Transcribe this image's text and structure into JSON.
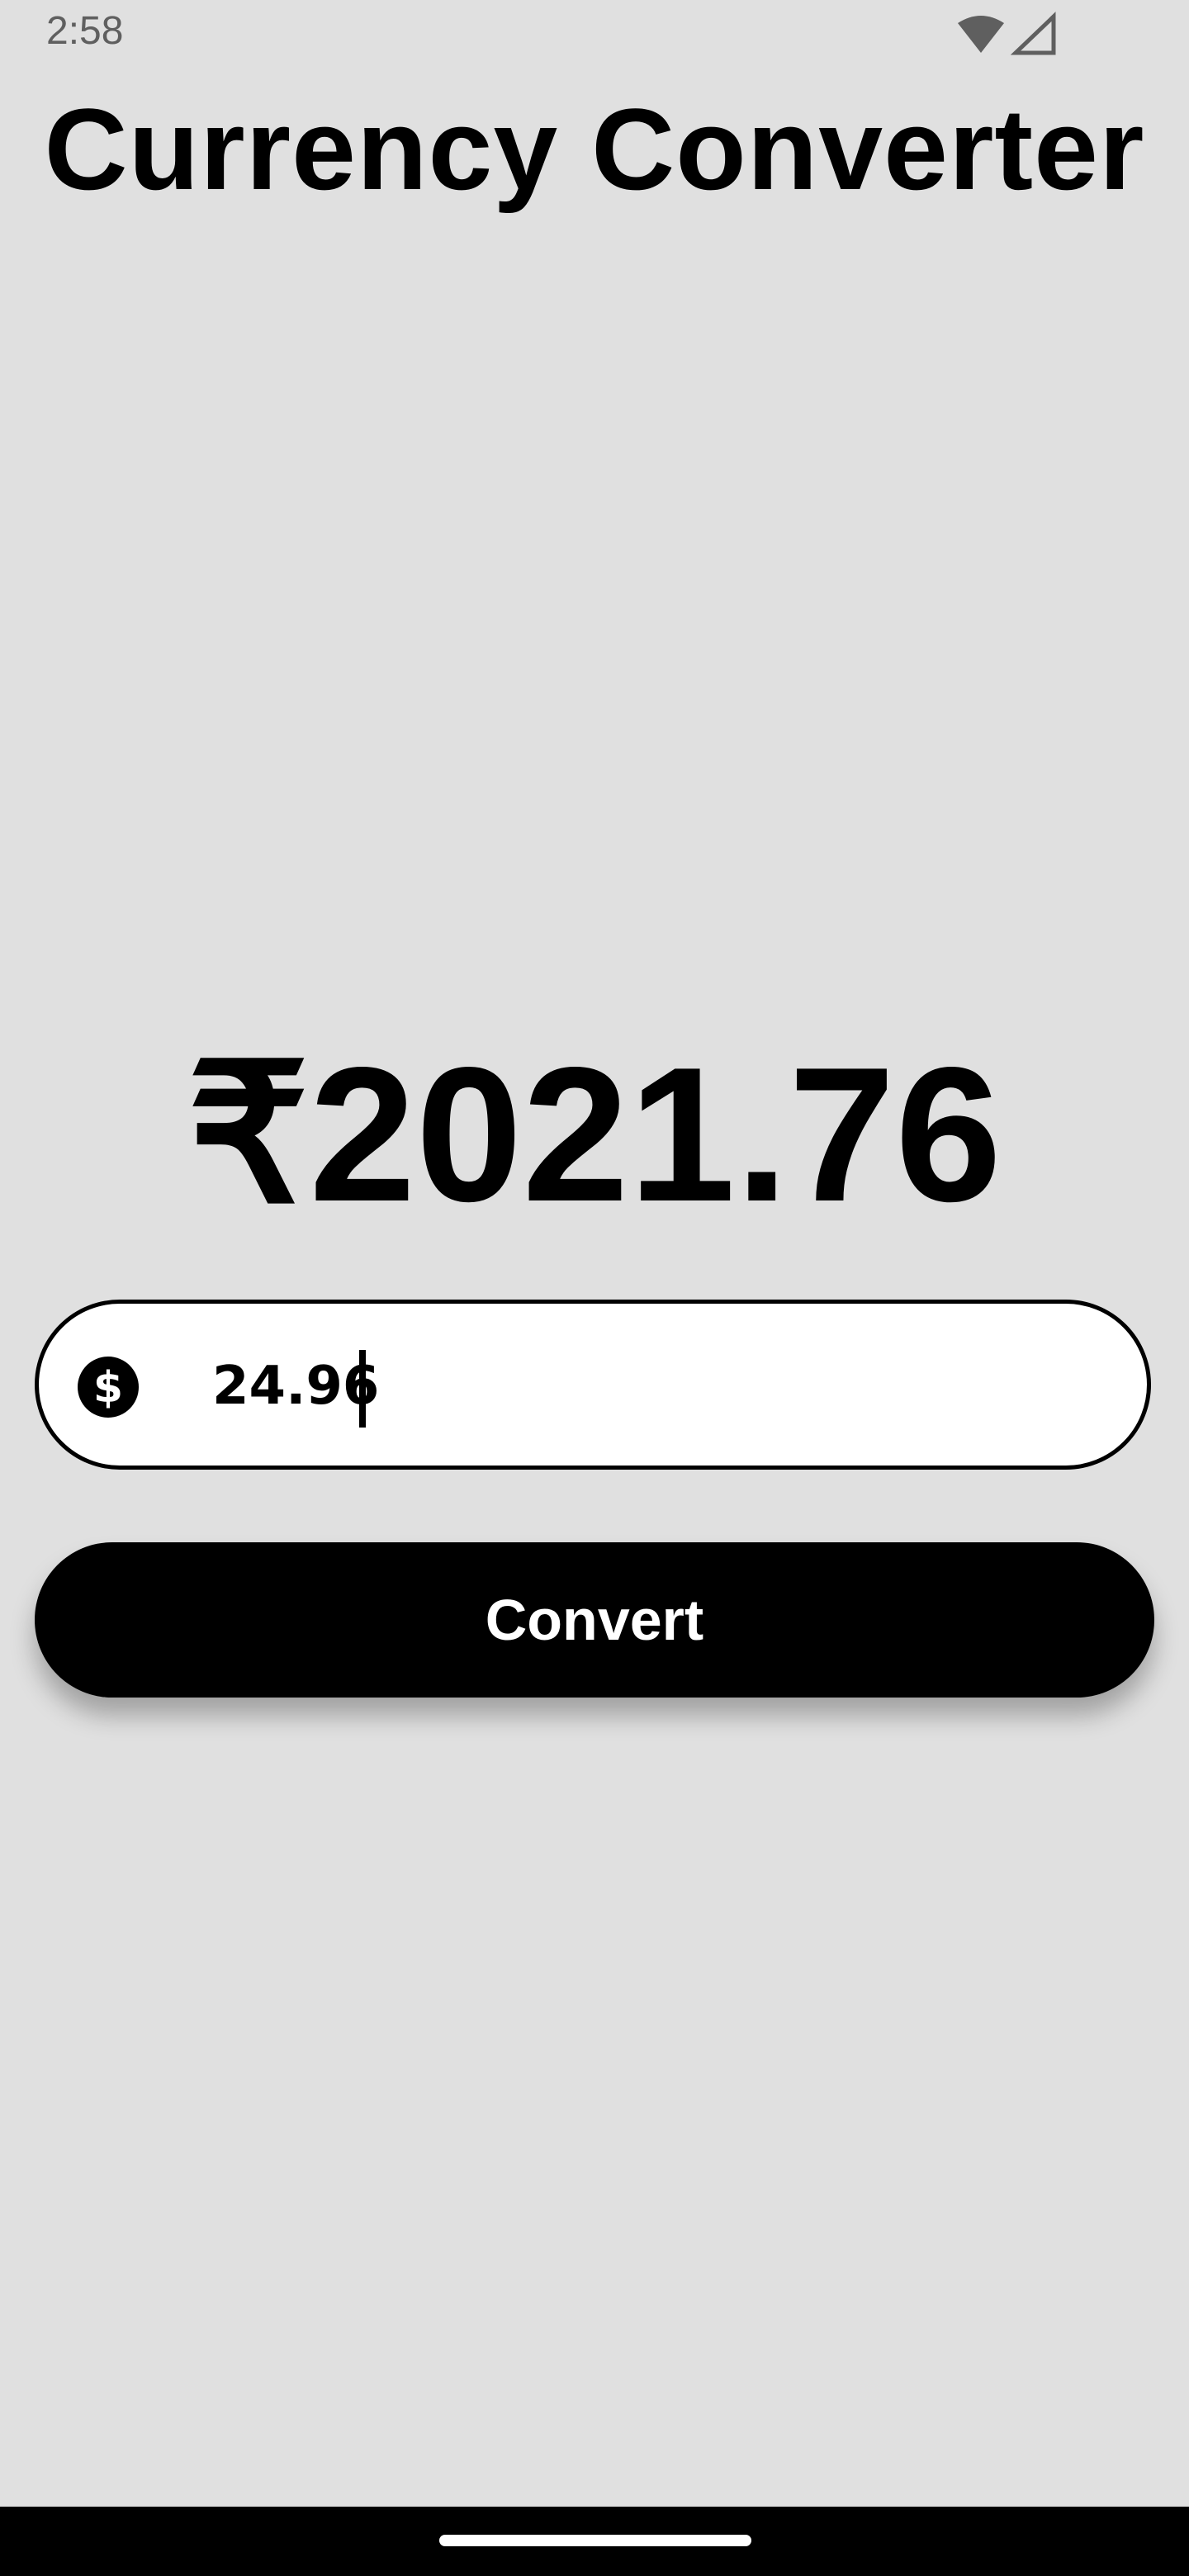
{
  "status_bar": {
    "time": "2:58",
    "icons": [
      "wifi-icon",
      "cellular-signal-icon"
    ]
  },
  "app": {
    "title": "Currency Converter"
  },
  "result": {
    "value": "₹2021.76"
  },
  "amount_input": {
    "value": "24.96",
    "icon": "dollar-circle-icon"
  },
  "convert_button": {
    "label": "Convert"
  },
  "colors": {
    "background": "#e0e0e0",
    "primary": "#000000",
    "input_background": "#ffffff",
    "status_text": "#5f5f5f"
  }
}
